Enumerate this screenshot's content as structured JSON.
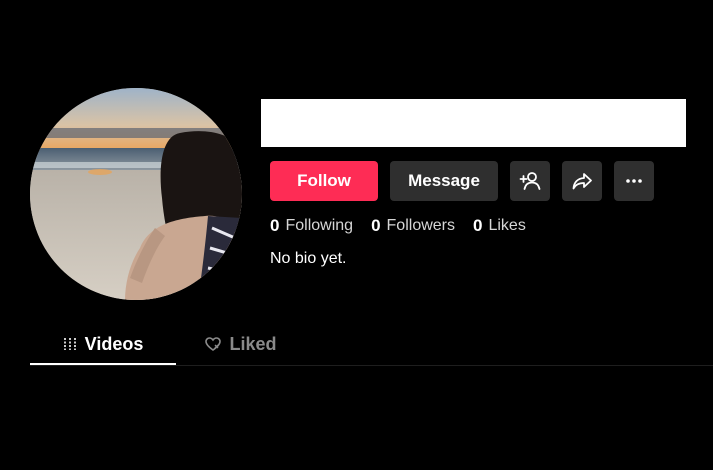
{
  "profile": {
    "follow_label": "Follow",
    "message_label": "Message",
    "stats": {
      "following_count": "0",
      "following_label": "Following",
      "followers_count": "0",
      "followers_label": "Followers",
      "likes_count": "0",
      "likes_label": "Likes"
    },
    "bio": "No bio yet."
  },
  "tabs": {
    "videos_label": "Videos",
    "liked_label": "Liked"
  },
  "icons": {
    "add_friend": "add-user-icon",
    "share": "share-icon",
    "more": "more-icon",
    "videos": "grid-icon",
    "liked": "heart-icon"
  },
  "colors": {
    "background": "#000000",
    "accent": "#fe2c55",
    "button_dark": "#2f2f2f",
    "muted_text": "#8a8a8a"
  }
}
